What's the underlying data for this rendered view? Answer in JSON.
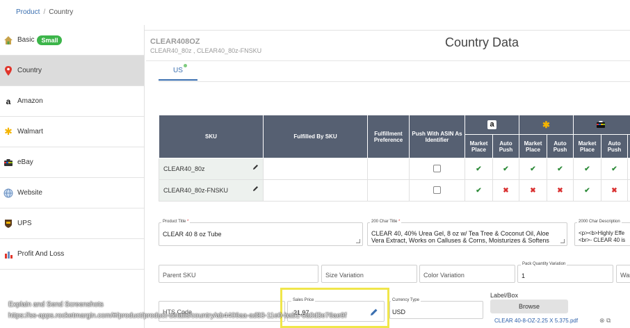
{
  "breadcrumb": {
    "root": "Product",
    "separator": "/",
    "current": "Country"
  },
  "sidebar": {
    "items": [
      {
        "label": "Basic",
        "badge": "Small",
        "icon": "house-icon",
        "active": false
      },
      {
        "label": "Country",
        "icon": "map-pin-icon",
        "active": true
      },
      {
        "label": "Amazon",
        "icon": "amazon-icon",
        "active": false
      },
      {
        "label": "Walmart",
        "icon": "walmart-icon",
        "active": false
      },
      {
        "label": "eBay",
        "icon": "ebay-icon",
        "active": false
      },
      {
        "label": "Website",
        "icon": "globe-icon",
        "active": false
      },
      {
        "label": "UPS",
        "icon": "ups-icon",
        "active": false
      },
      {
        "label": "Profit And Loss",
        "icon": "profit-chart-icon",
        "active": false
      }
    ]
  },
  "header": {
    "sku_code": "CLEAR408OZ",
    "sku_sub": "CLEAR40_80z , CLEAR40_80z-FNSKU",
    "title": "Country Data"
  },
  "tabs": [
    {
      "label": "US",
      "active": true
    }
  ],
  "table": {
    "headers": {
      "sku": "SKU",
      "fulfilled_by": "Fulfilled By SKU",
      "fulfillment_pref": "Fulfillment Preference",
      "push_asin": "Push With ASIN As Identifier",
      "market_place": "Market Place",
      "auto_push": "Auto Push"
    },
    "channels": [
      "amazon-channel-icon",
      "walmart-channel-icon",
      "ebay-channel-icon"
    ],
    "rows": [
      {
        "sku": "CLEAR40_80z",
        "push_asin": false,
        "marks": [
          "check",
          "check",
          "check",
          "check",
          "check",
          "check"
        ]
      },
      {
        "sku": "CLEAR40_80z-FNSKU",
        "push_asin": false,
        "marks": [
          "check",
          "cross",
          "cross",
          "cross",
          "check",
          "cross"
        ]
      }
    ]
  },
  "form": {
    "product_title": {
      "label": "Product Title",
      "value": "CLEAR 40 8 oz Tube"
    },
    "char200_title": {
      "label": "200 Char Title",
      "value": "CLEAR 40, 40% Urea Gel, 8 oz w/ Tea Tree & Coconut Oil, Aloe Vera Extract, Works on Calluses & Corns, Moisturizes & Softens"
    },
    "char2000_desc": {
      "label": "2000 Char Description",
      "value": "<p><b>Highly Effe <br>- CLEAR 40 is"
    },
    "parent_sku": {
      "placeholder": "Parent SKU"
    },
    "size_variation": {
      "placeholder": "Size Variation"
    },
    "color_variation": {
      "placeholder": "Color Variation"
    },
    "pack_quantity": {
      "label": "Pack Quantity Variation",
      "value": "1"
    },
    "warehouse": {
      "placeholder": "War"
    },
    "hts_code": {
      "placeholder": "HTS Code"
    },
    "sales_price": {
      "label": "Sales Price",
      "value": "21.97"
    },
    "currency": {
      "label": "Currency Type",
      "value": "USD"
    },
    "label_box": {
      "label": "Label/Box",
      "browse": "Browse",
      "file": "CLEAR 40-8-OZ-2.25 X 5.375.pdf"
    }
  },
  "overlay": {
    "title": "Explain and Send Screenshots",
    "url": "https://ss-apps.rocketmargin.com/#/product/product-details/country/ab4406aa-ad83-11e0-bab1-0a0d3e76ae9f"
  },
  "colors": {
    "header_bg": "#566072",
    "accent": "#3a6fb0",
    "check": "#2e8b3a",
    "cross": "#d93030",
    "highlight": "#f0e64a",
    "badge": "#3cb54a"
  }
}
